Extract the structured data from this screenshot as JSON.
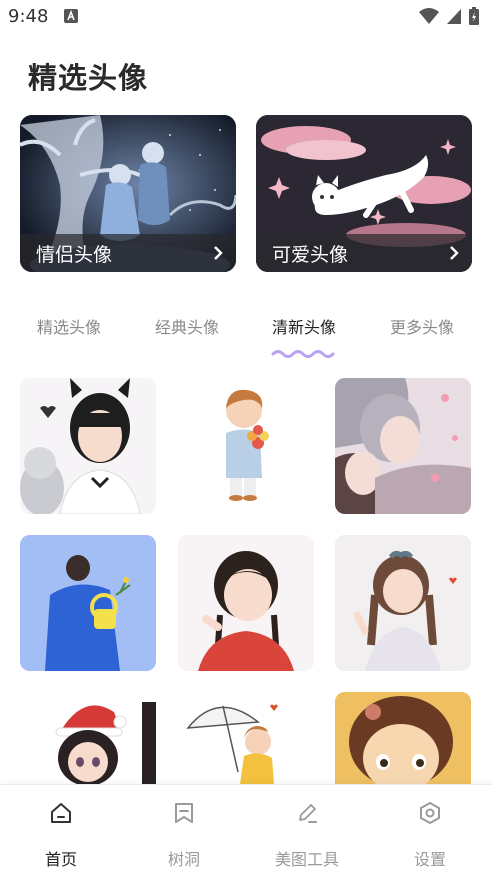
{
  "status": {
    "time": "9:48",
    "icons": [
      "app-notification-icon",
      "wifi-icon",
      "signal-icon",
      "battery-charging-icon"
    ]
  },
  "header": {
    "title": "精选头像"
  },
  "cards": [
    {
      "label": "情侣头像",
      "icon": "chevron-right-icon"
    },
    {
      "label": "可爱头像",
      "icon": "chevron-right-icon"
    }
  ],
  "tabs": [
    {
      "label": "精选头像",
      "active": false
    },
    {
      "label": "经典头像",
      "active": false
    },
    {
      "label": "清新头像",
      "active": true
    },
    {
      "label": "更多头像",
      "active": false
    }
  ],
  "grid": {
    "rows": 3,
    "columns": 3,
    "accent": "#b9a3f0"
  },
  "bottom_nav": [
    {
      "label": "首页",
      "icon": "home-icon",
      "active": true
    },
    {
      "label": "树洞",
      "icon": "bookmark-icon",
      "active": false
    },
    {
      "label": "美图工具",
      "icon": "pen-icon",
      "active": false
    },
    {
      "label": "设置",
      "icon": "hexagon-settings-icon",
      "active": false
    }
  ]
}
